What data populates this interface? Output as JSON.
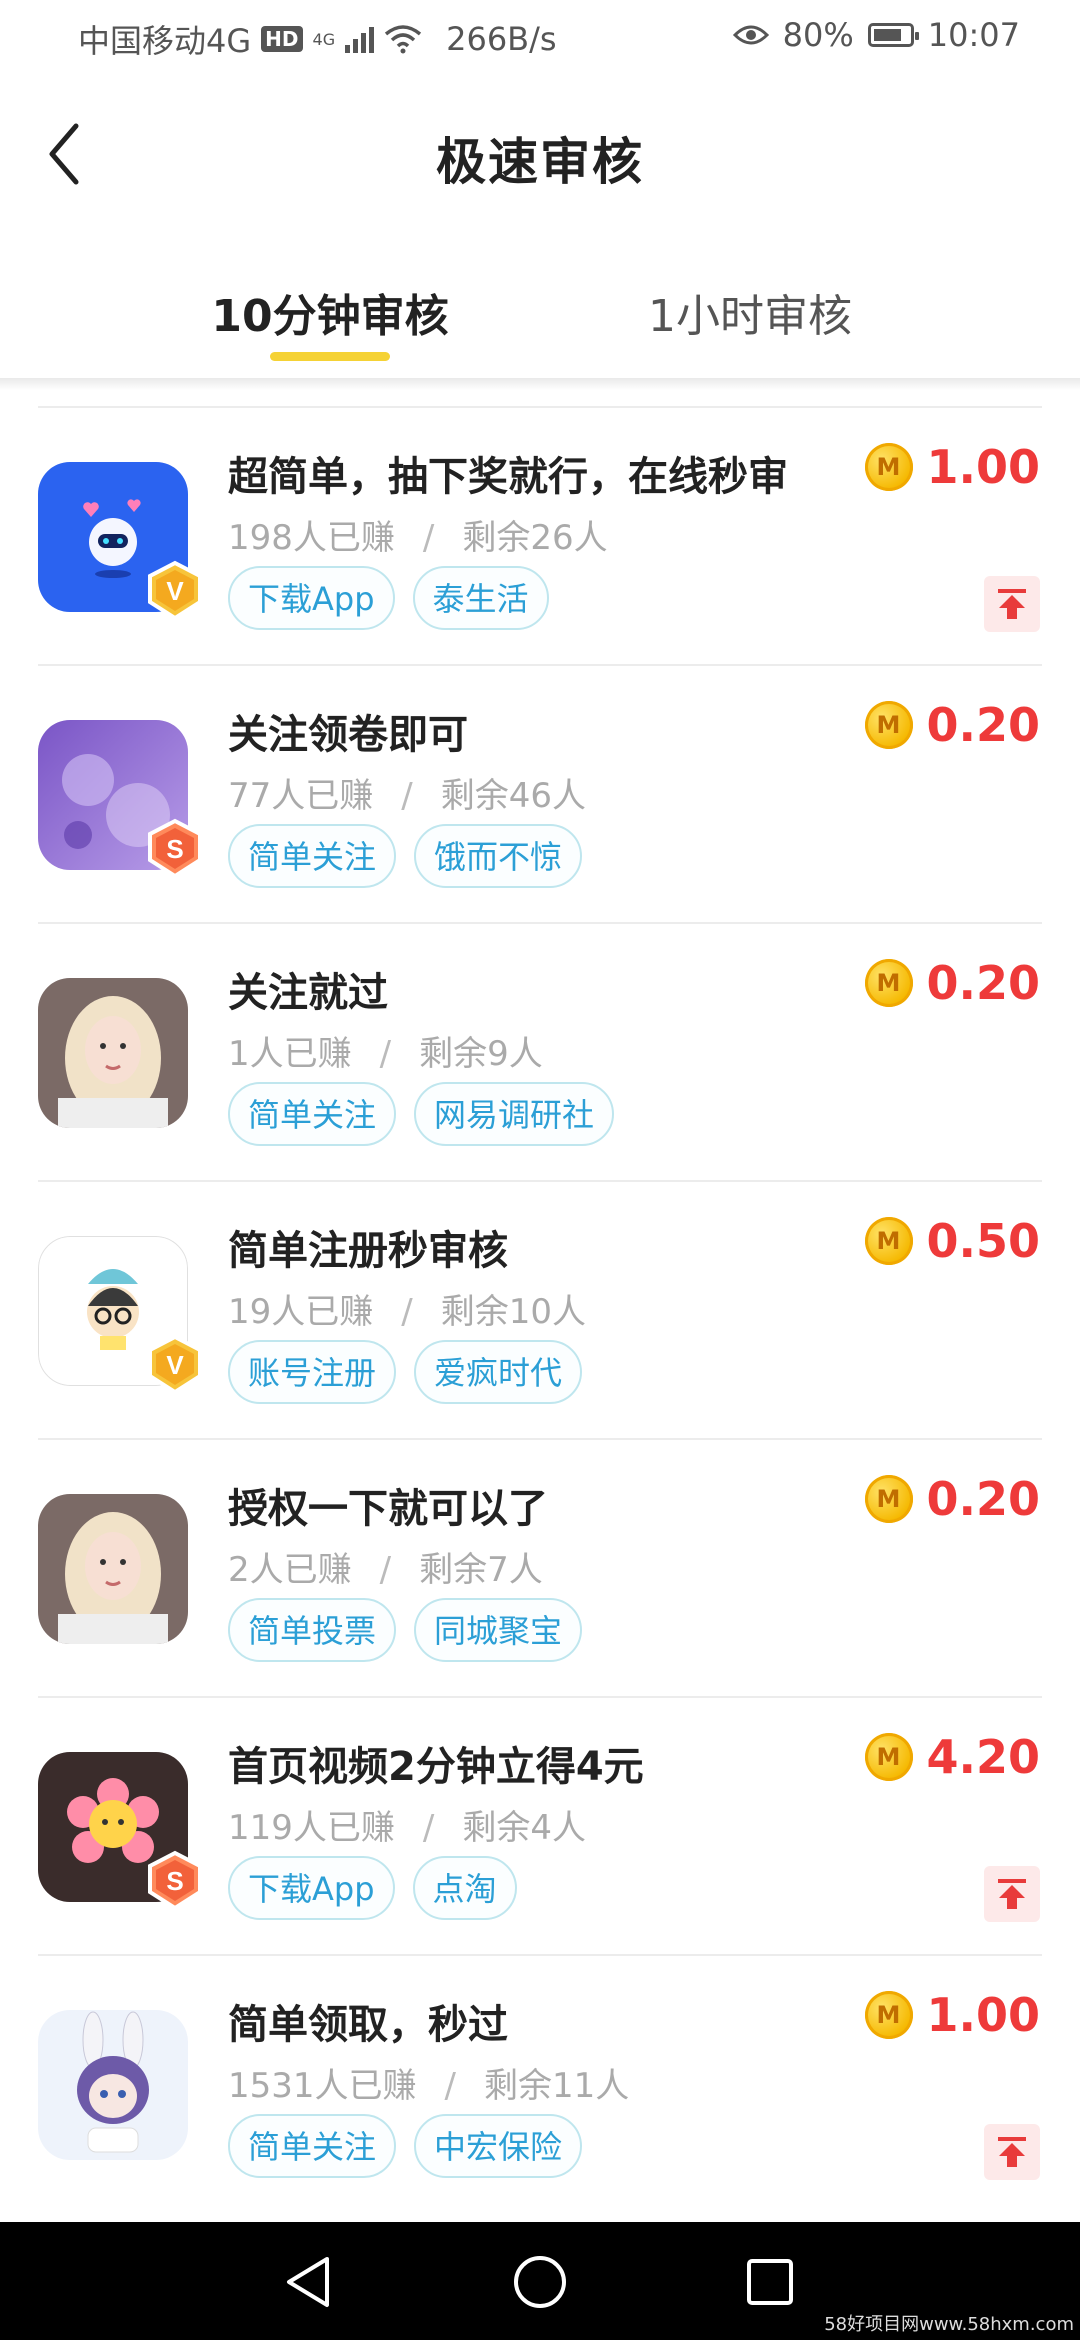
{
  "status_bar": {
    "carrier": "中国移动4G",
    "hd": "HD",
    "net": "4G",
    "speed": "266B/s",
    "battery": "80%",
    "battery_level": 0.8,
    "time": "10:07"
  },
  "header": {
    "title": "极速审核"
  },
  "tabs": [
    {
      "label": "10分钟审核",
      "active": true
    },
    {
      "label": "1小时审核",
      "active": false
    }
  ],
  "tasks": [
    {
      "title": "超简单，抽下奖就行，在线秒审",
      "earned": "198人已赚",
      "sep": "/",
      "remaining": "剩余26人",
      "tags": [
        "下载App",
        "泰生活"
      ],
      "reward": "1.00",
      "coin": "M",
      "badge": "V",
      "avatar": "robot",
      "has_top": true
    },
    {
      "title": "关注领卷即可",
      "earned": "77人已赚",
      "sep": "/",
      "remaining": "剩余46人",
      "tags": [
        "简单关注",
        "饿而不惊"
      ],
      "reward": "0.20",
      "coin": "M",
      "badge": "S",
      "avatar": "purple",
      "has_top": false
    },
    {
      "title": "关注就过",
      "earned": "1人已赚",
      "sep": "/",
      "remaining": "剩余9人",
      "tags": [
        "简单关注",
        "网易调研社"
      ],
      "reward": "0.20",
      "coin": "M",
      "badge": "",
      "avatar": "girl",
      "has_top": false
    },
    {
      "title": "简单注册秒审核",
      "earned": "19人已赚",
      "sep": "/",
      "remaining": "剩余10人",
      "tags": [
        "账号注册",
        "爱疯时代"
      ],
      "reward": "0.50",
      "coin": "M",
      "badge": "V",
      "avatar": "cartoon",
      "has_top": false
    },
    {
      "title": "授权一下就可以了",
      "earned": "2人已赚",
      "sep": "/",
      "remaining": "剩余7人",
      "tags": [
        "简单投票",
        "同城聚宝"
      ],
      "reward": "0.20",
      "coin": "M",
      "badge": "",
      "avatar": "girl",
      "has_top": false
    },
    {
      "title": "首页视频2分钟立得4元",
      "earned": "119人已赚",
      "sep": "/",
      "remaining": "剩余4人",
      "tags": [
        "下载App",
        "点淘"
      ],
      "reward": "4.20",
      "coin": "M",
      "badge": "S",
      "avatar": "flower",
      "has_top": true
    },
    {
      "title": "简单领取，秒过",
      "earned": "1531人已赚",
      "sep": "/",
      "remaining": "剩余11人",
      "tags": [
        "简单关注",
        "中宏保险"
      ],
      "reward": "1.00",
      "coin": "M",
      "badge": "",
      "avatar": "bunny",
      "has_top": true
    }
  ],
  "watermark": "58好项目网www.58hxm.com",
  "colors": {
    "accent_yellow": "#f5d235",
    "reward_red": "#ee3a3a",
    "tag_blue": "#2b9fd6"
  }
}
